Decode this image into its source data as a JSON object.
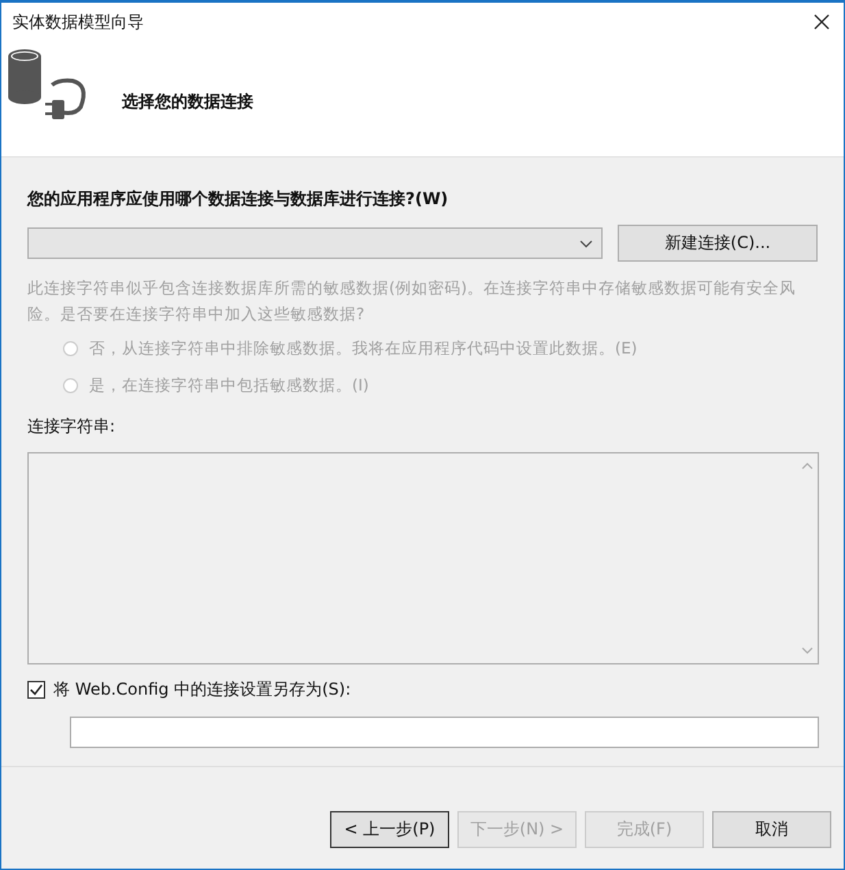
{
  "window": {
    "title": "实体数据模型向导"
  },
  "header": {
    "title": "选择您的数据连接"
  },
  "connection": {
    "label": "您的应用程序应使用哪个数据连接与数据库进行连接?(W)",
    "new_button": "新建连接(C)..."
  },
  "sensitive": {
    "text": "此连接字符串似乎包含连接数据库所需的敏感数据(例如密码)。在连接字符串中存储敏感数据可能有安全风险。是否要在连接字符串中加入这些敏感数据?",
    "disabled": true,
    "options": [
      {
        "label": "否，从连接字符串中排除敏感数据。我将在应用程序代码中设置此数据。(E)",
        "selected": false,
        "disabled": true
      },
      {
        "label": "是，在连接字符串中包括敏感数据。(I)",
        "selected": false,
        "disabled": true
      }
    ]
  },
  "connection_string": {
    "label": "连接字符串:"
  },
  "save_config": {
    "label": "将 Web.Config 中的连接设置另存为(S):",
    "checked": true
  },
  "buttons": [
    {
      "label": "< 上一步(P)",
      "disabled": false
    },
    {
      "label": "下一步(N) >",
      "disabled": true
    },
    {
      "label": "完成(F)",
      "disabled": true
    },
    {
      "label": "取消",
      "disabled": false
    }
  ]
}
